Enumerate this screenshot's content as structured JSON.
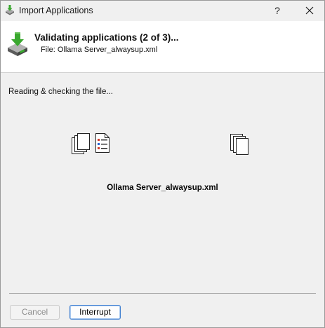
{
  "window": {
    "title": "Import Applications",
    "help_label": "?",
    "close_label": "✕"
  },
  "header": {
    "title": "Validating applications (2 of 3)...",
    "file_line": "File: Ollama Server_alwaysup.xml"
  },
  "main": {
    "status": "Reading & checking the file...",
    "file_name": "Ollama Server_alwaysup.xml"
  },
  "buttons": {
    "cancel_label": "Cancel",
    "cancel_enabled": false,
    "interrupt_label": "Interrupt"
  },
  "colors": {
    "accent_green": "#3aa82f",
    "focus_blue": "#3f7fd0",
    "checklist_red": "#d23b2b",
    "checklist_blue": "#2b64d2"
  }
}
